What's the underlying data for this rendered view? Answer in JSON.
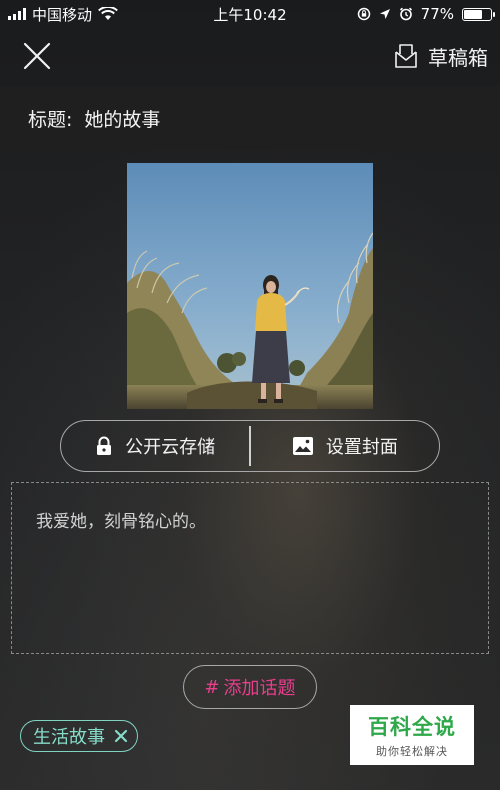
{
  "status_bar": {
    "carrier": "中国移动",
    "time": "上午10:42",
    "battery_percent": "77%",
    "battery_level": 0.77,
    "icons": [
      "signal-icon",
      "wifi-icon",
      "rotation-lock-icon",
      "location-icon",
      "alarm-icon",
      "battery-icon"
    ]
  },
  "header": {
    "close_icon": "close-icon",
    "drafts_label": "草稿箱",
    "drafts_icon": "drafts-icon"
  },
  "title_bar": {
    "label": "标题:",
    "value": "她的故事"
  },
  "options": {
    "public_storage_label": "公开云存储",
    "public_storage_icon": "lock-icon",
    "set_cover_label": "设置封面",
    "set_cover_icon": "image-icon"
  },
  "editor": {
    "content": "我爱她，刻骨铭心的。"
  },
  "add_topic": {
    "hash": "#",
    "label": "添加话题"
  },
  "tag": {
    "label": "生活故事",
    "remove_icon": "close-icon"
  },
  "watermark": {
    "main": "百科全说",
    "sub": "助你轻松解决"
  },
  "colors": {
    "topic_accent": "#e83e8c",
    "tag_accent": "#86dcc9",
    "watermark_green": "#2fa84a"
  }
}
